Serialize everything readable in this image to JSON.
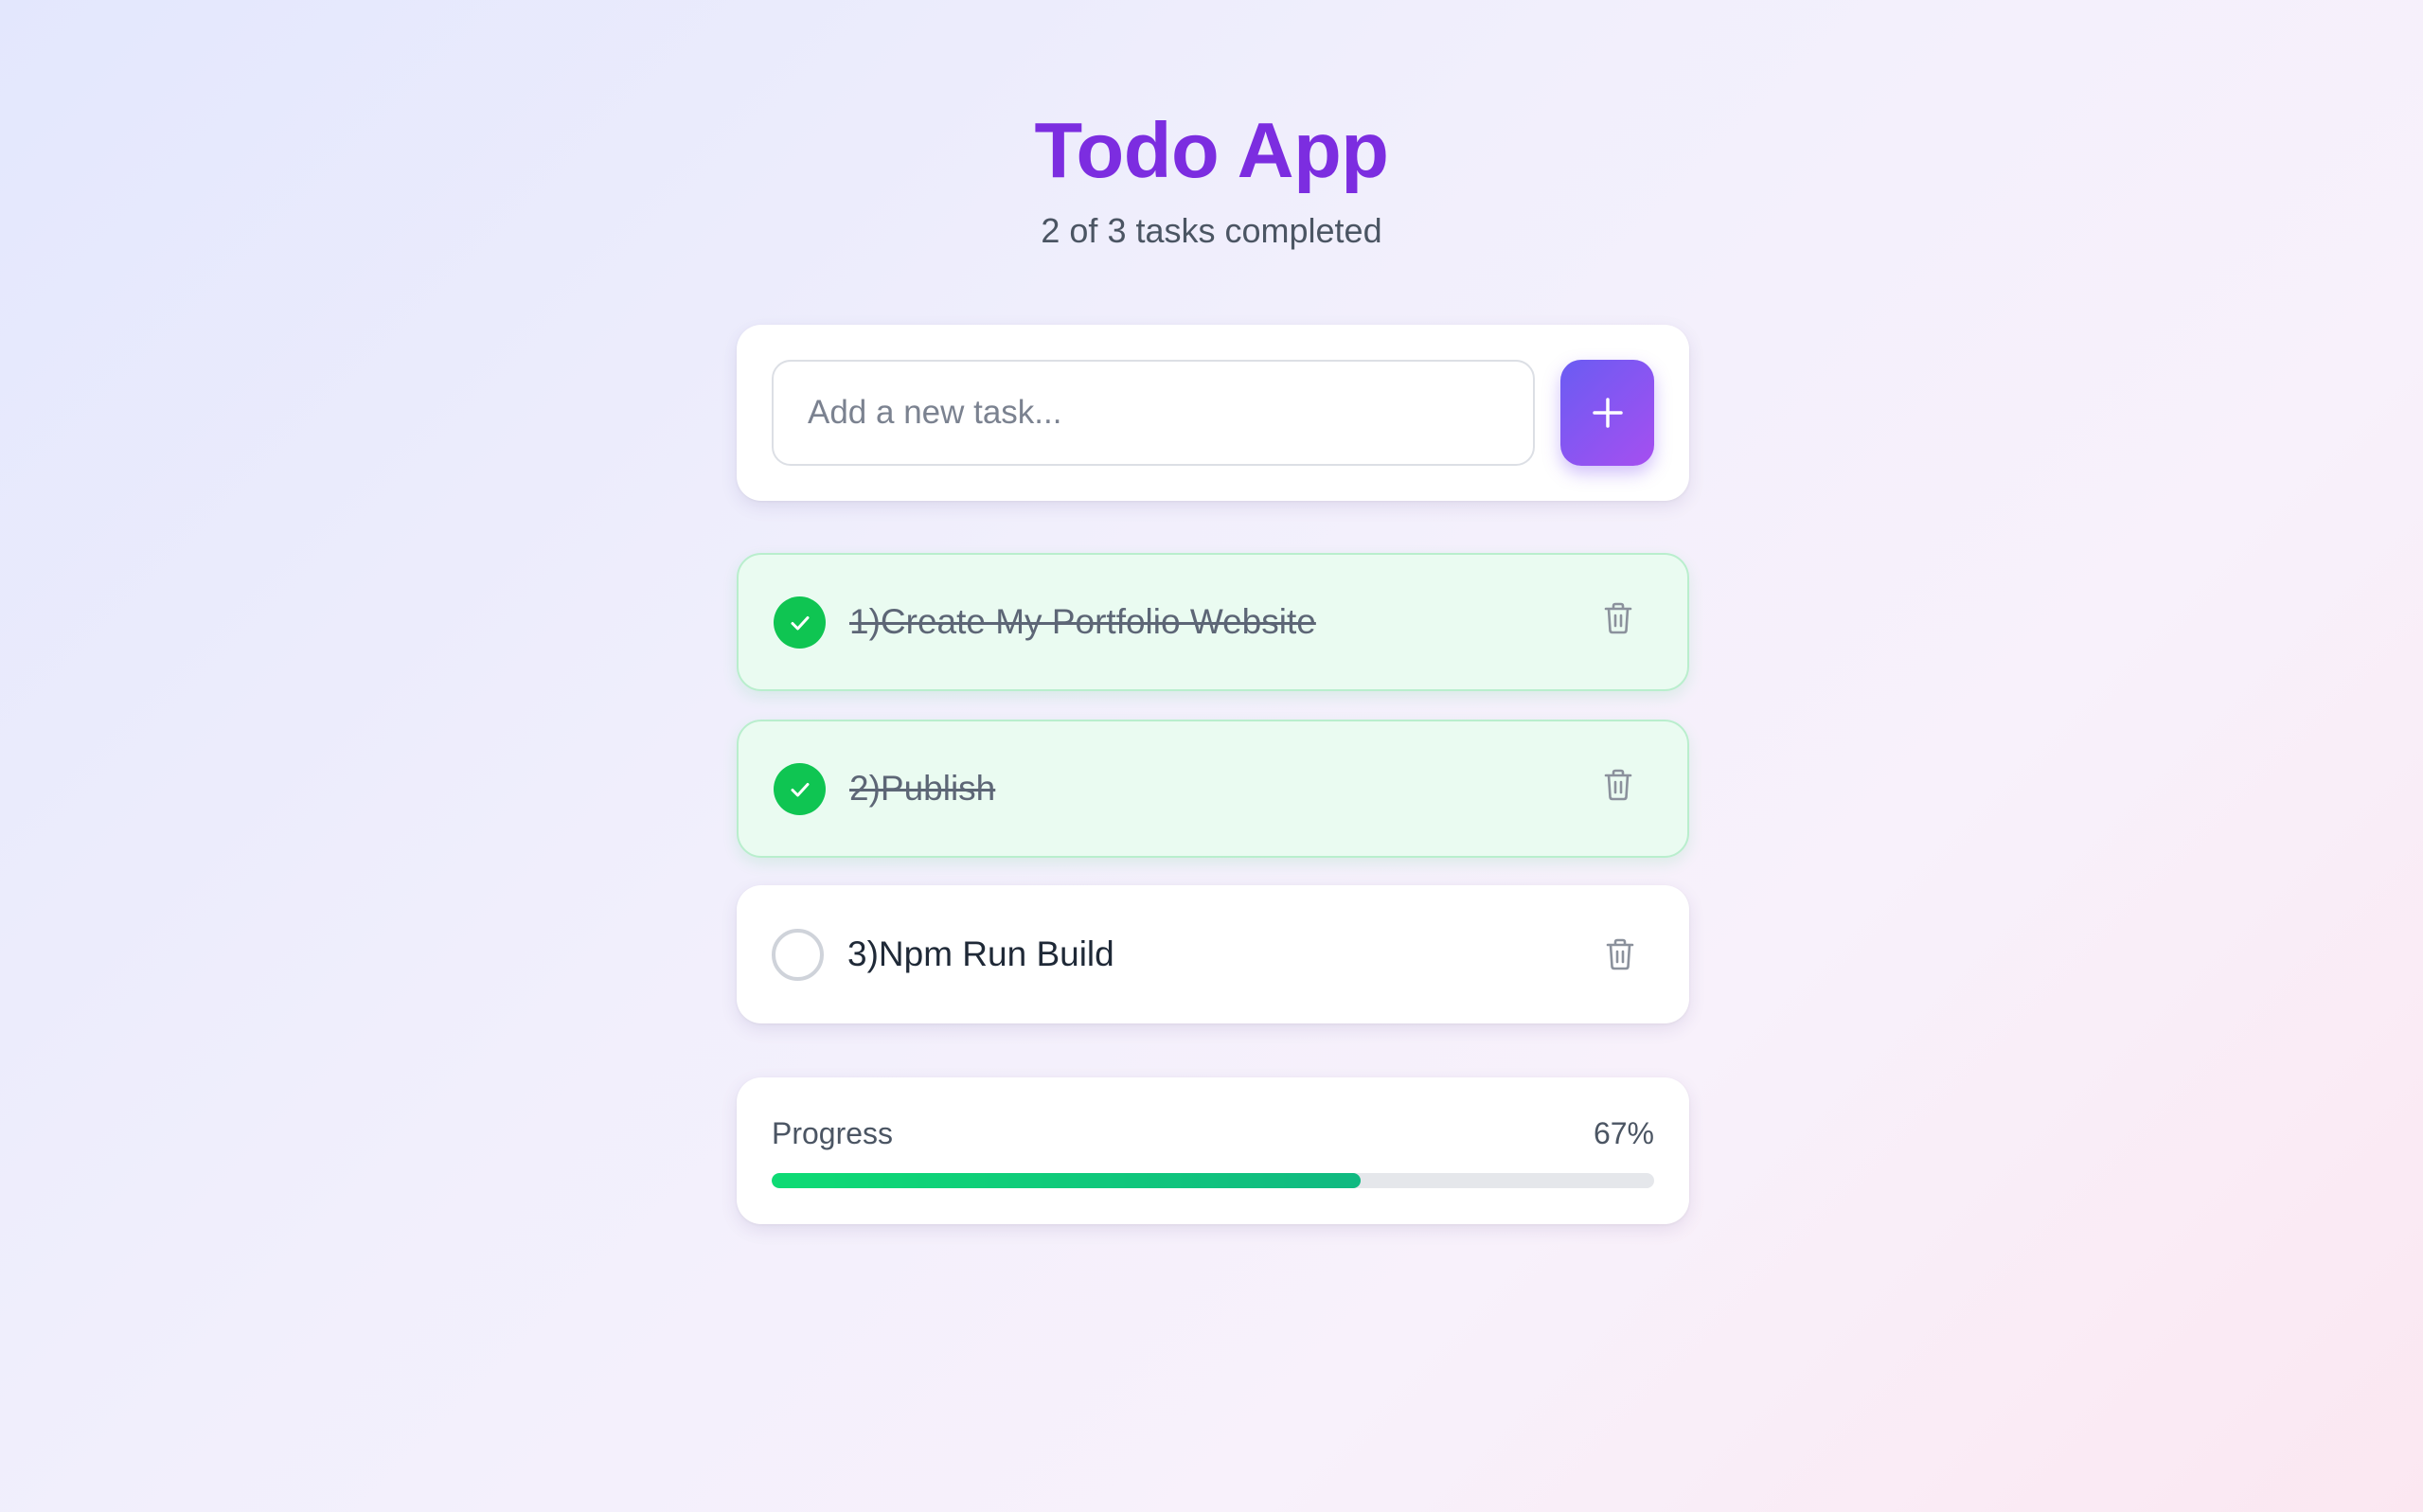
{
  "header": {
    "title": "Todo App",
    "subtitle": "2 of 3 tasks completed"
  },
  "add_task": {
    "placeholder": "Add a new task...",
    "value": "",
    "button_icon": "plus-icon"
  },
  "tasks": [
    {
      "label": "1)Create My Portfolio Website",
      "completed": true,
      "delete_icon": "trash-icon"
    },
    {
      "label": "2)Publish",
      "completed": true,
      "delete_icon": "trash-icon"
    },
    {
      "label": "3)Npm Run Build",
      "completed": false,
      "delete_icon": "trash-icon"
    }
  ],
  "progress": {
    "label": "Progress",
    "value_text": "67%",
    "fraction": 0.667
  },
  "colors": {
    "accent": "#7c2de0",
    "add_button_gradient": [
      "#6a5cf3",
      "#a64ff0"
    ],
    "done_check": "#0fc552",
    "done_background": "#eafbf1",
    "progress_fill": "#0edb74"
  }
}
